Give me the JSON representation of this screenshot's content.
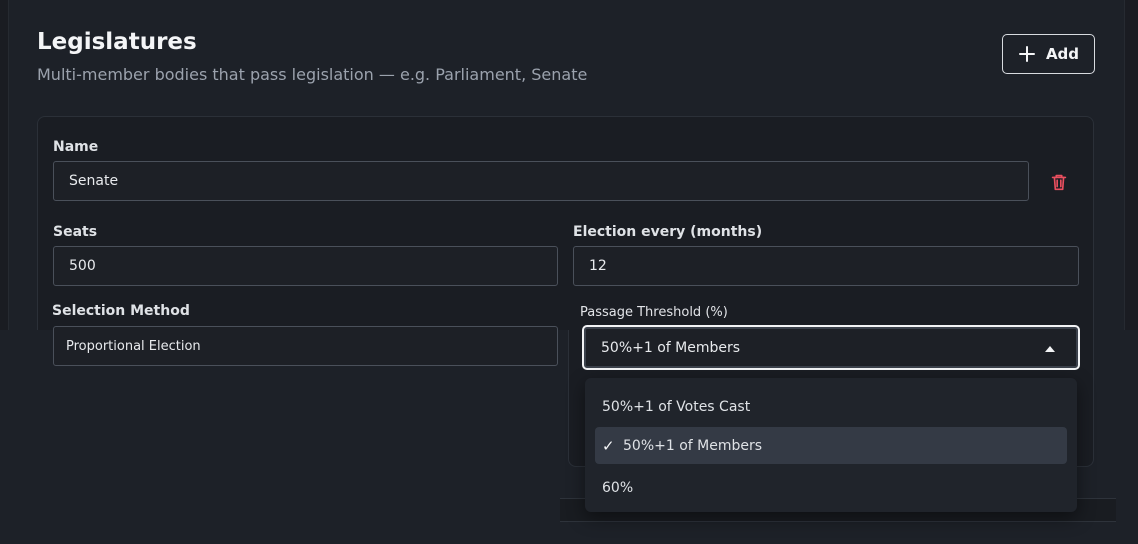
{
  "section": {
    "title": "Legislatures",
    "description": "Multi-member bodies that pass legislation — e.g. Parliament, Senate",
    "add_label": "Add"
  },
  "legislature": {
    "name_label": "Name",
    "name_value": "Senate",
    "seats_label": "Seats",
    "seats_value": "500",
    "election_label": "Election every (months)",
    "election_value": "12",
    "selection_label": "Selection Method",
    "selection_value": "Proportional Election",
    "threshold_label": "Passage Threshold (%)",
    "threshold_value": "50%+1 of Members"
  },
  "threshold_options": [
    {
      "label": "50%+1 of Votes Cast",
      "selected": false
    },
    {
      "label": "50%+1 of Members",
      "selected": true
    },
    {
      "label": "60%",
      "selected": false
    }
  ],
  "icons": {
    "add": "plus-icon",
    "delete": "trash-icon",
    "dropdown": "caret-up-icon",
    "selected": "check-icon"
  },
  "colors": {
    "background": "#1d2128",
    "delete_icon": "#ea4f5f",
    "active_option": "#343a45"
  }
}
